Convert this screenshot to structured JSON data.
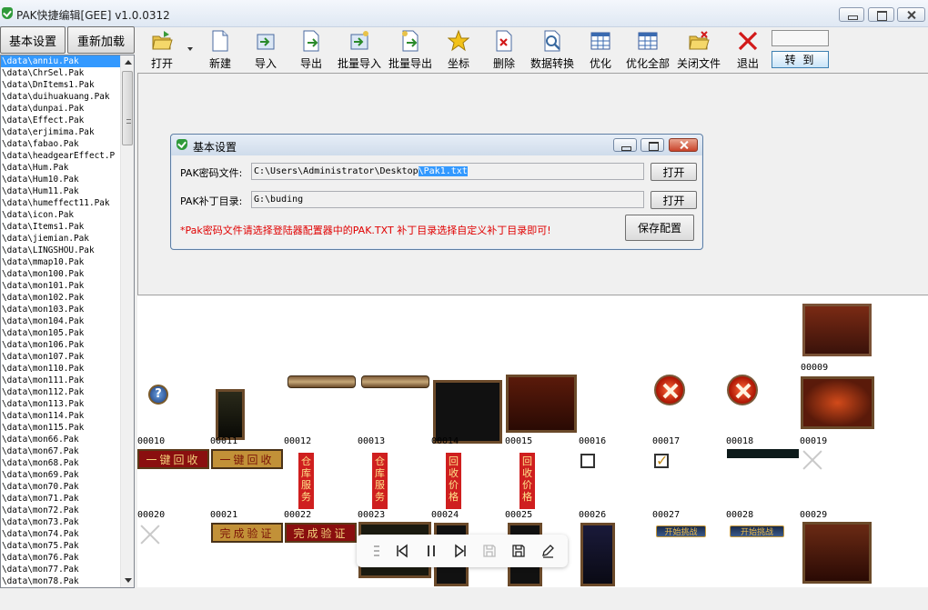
{
  "window": {
    "title": "PAK快捷编辑[GEE] v1.0.0312"
  },
  "left_buttons": {
    "basic_settings": "基本设置",
    "reload": "重新加载"
  },
  "toolbar": {
    "items": [
      {
        "label": "打开",
        "icon": "folder-open-icon"
      },
      {
        "label": "新建",
        "icon": "new-document-icon"
      },
      {
        "label": "导入",
        "icon": "import-icon"
      },
      {
        "label": "导出",
        "icon": "export-icon"
      },
      {
        "label": "批量导入",
        "icon": "batch-import-icon"
      },
      {
        "label": "批量导出",
        "icon": "batch-export-icon"
      },
      {
        "label": "坐标",
        "icon": "star-icon"
      },
      {
        "label": "删除",
        "icon": "delete-icon"
      },
      {
        "label": "数据转换",
        "icon": "convert-icon"
      },
      {
        "label": "优化",
        "icon": "grid-icon"
      },
      {
        "label": "优化全部",
        "icon": "grid-all-icon"
      },
      {
        "label": "关闭文件",
        "icon": "close-file-icon"
      },
      {
        "label": "退出",
        "icon": "exit-x-icon"
      }
    ],
    "goto_label": "转 到",
    "goto_value": ""
  },
  "file_list": [
    "\\data\\anniu.Pak",
    "\\data\\ChrSel.Pak",
    "\\data\\DnItems1.Pak",
    "\\data\\duihuakuang.Pak",
    "\\data\\dunpai.Pak",
    "\\data\\Effect.Pak",
    "\\data\\erjimima.Pak",
    "\\data\\fabao.Pak",
    "\\data\\headgearEffect.P",
    "\\data\\Hum.Pak",
    "\\data\\Hum10.Pak",
    "\\data\\Hum11.Pak",
    "\\data\\humeffect11.Pak",
    "\\data\\icon.Pak",
    "\\data\\Items1.Pak",
    "\\data\\jiemian.Pak",
    "\\data\\LINGSHOU.Pak",
    "\\data\\mmap10.Pak",
    "\\data\\mon100.Pak",
    "\\data\\mon101.Pak",
    "\\data\\mon102.Pak",
    "\\data\\mon103.Pak",
    "\\data\\mon104.Pak",
    "\\data\\mon105.Pak",
    "\\data\\mon106.Pak",
    "\\data\\mon107.Pak",
    "\\data\\mon110.Pak",
    "\\data\\mon111.Pak",
    "\\data\\mon112.Pak",
    "\\data\\mon113.Pak",
    "\\data\\mon114.Pak",
    "\\data\\mon115.Pak",
    "\\data\\mon66.Pak",
    "\\data\\mon67.Pak",
    "\\data\\mon68.Pak",
    "\\data\\mon69.Pak",
    "\\data\\mon70.Pak",
    "\\data\\mon71.Pak",
    "\\data\\mon72.Pak",
    "\\data\\mon73.Pak",
    "\\data\\mon74.Pak",
    "\\data\\mon75.Pak",
    "\\data\\mon76.Pak",
    "\\data\\mon77.Pak",
    "\\data\\mon78.Pak"
  ],
  "dialog": {
    "title": "基本设置",
    "pak_pw_label": "PAK密码文件:",
    "pak_pw_value_prefix": "C:\\Users\\Administrator\\Desktop",
    "pak_pw_value_selected": "\\Pak1.txt",
    "patch_dir_label": "PAK补丁目录:",
    "patch_dir_value": "G:\\buding",
    "open_label": "打开",
    "save_label": "保存配置",
    "note": "*Pak密码文件请选择登陆器配置器中的PAK.TXT 补丁目录选择自定义补丁目录即可!"
  },
  "thumbnails": {
    "labels": [
      "00009",
      "00010",
      "00011",
      "00012",
      "00013",
      "00014",
      "00015",
      "00016",
      "00017",
      "00018",
      "00019",
      "00020",
      "00021",
      "00022",
      "00023",
      "00024",
      "00025",
      "00026",
      "00027",
      "00028",
      "00029"
    ],
    "red_button_text": "一键回收",
    "gold_button_text": "一键回收",
    "verify_gold_text": "完成验证",
    "verify_red_text": "完成验证",
    "flag_warehouse": "仓库服务",
    "flag_recycle": "回收价格",
    "small_banner_1": "开始挑战",
    "small_banner_2": "开始挑战"
  },
  "colors": {
    "selection": "#3399ff",
    "note_red": "#e00000"
  }
}
